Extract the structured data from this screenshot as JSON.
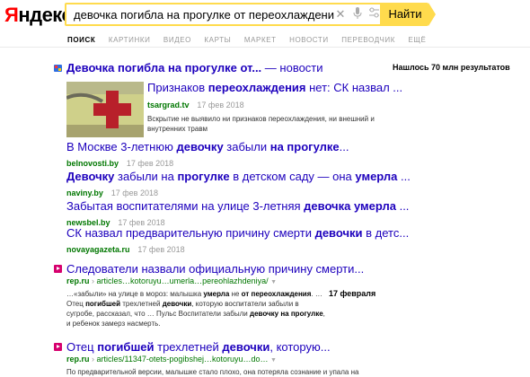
{
  "header": {
    "logo_first": "Я",
    "logo_rest": "ндекс",
    "query": "девочка погибла на прогулке от переохлаждения",
    "find_label": "Найти"
  },
  "tabs": [
    "ПОИСК",
    "КАРТИНКИ",
    "ВИДЕО",
    "КАРТЫ",
    "МАРКЕТ",
    "НОВОСТИ",
    "ПЕРЕВОДЧИК",
    "ЕЩЁ"
  ],
  "result_count": "Нашлось 70 млн результатов",
  "news": {
    "title_b": "Девочка погибла на прогулке от...",
    "title_rest": " — новости",
    "thumb_item": {
      "title_pre": "Признаков ",
      "title_b": "переохлаждения",
      "title_post": " нет: СК назвал ...",
      "source": "tsargrad.tv",
      "date": "17 фев 2018",
      "snippet": "Вскрытие не выявило ни признаков переохлаждения, ни внешний и внутренних травм"
    },
    "items": [
      {
        "title_pre": "В Москве 3-летнюю ",
        "title_b1": "девочку",
        "title_mid": " забыли ",
        "title_b2": "на прогулке",
        "title_post": "...",
        "source": "belnovosti.by",
        "date": "17 фев 2018"
      },
      {
        "title_pre": "",
        "title_b1": "Девочку",
        "title_mid": " забыли на ",
        "title_b2": "прогулке",
        "title_post": " в детском саду — она ",
        "title_b3": "умерла",
        "title_end": " ...",
        "source": "naviny.by",
        "date": "17 фев 2018"
      },
      {
        "title_pre": "Забытая воспитателями на улице 3-летняя ",
        "title_b1": "девочка умерла",
        "title_post": " ...",
        "source": "newsbel.by",
        "date": "17 фев 2018"
      },
      {
        "title_pre": "СК назвал предварительную причину смерти ",
        "title_b1": "девочки",
        "title_post": " в детс...",
        "source": "novayagazeta.ru",
        "date": "17 фев 2018"
      }
    ]
  },
  "results": [
    {
      "title": "Следователи назвали официальную причину смерти...",
      "domain": "rep.ru",
      "path": "articles…kotoruyu…umerla…pereohlazhdeniya/",
      "date": "17 февраля",
      "snippet_parts": [
        "…«забыли» на улице в мороз: малышка ",
        "умерла",
        " не ",
        "от переохлаждения",
        ". … Отец ",
        "погибшей",
        " трехлетней ",
        "девочки",
        ", которую воспитатели забыли в сугробе, рассказал, что … Пульс Воспитатели забыли ",
        "девочку на прогулке",
        ", и ребенок замерз насмерть."
      ]
    },
    {
      "title_pre": "Отец ",
      "title_b1": "погибшей",
      "title_mid": " трехлетней ",
      "title_b2": "девочки",
      "title_post": ", которую...",
      "domain": "rep.ru",
      "path": "articles/11347-otets-pogibshej…kotoruyu…do…",
      "snippet": "По предварительной версии, малышке стало плохо, она потеряла сознание и упала на"
    }
  ],
  "colors": {
    "accent_yellow": "#ffdb4d",
    "link": "#1d00bd",
    "url_green": "#007700",
    "logo_red": "#ff0000"
  }
}
